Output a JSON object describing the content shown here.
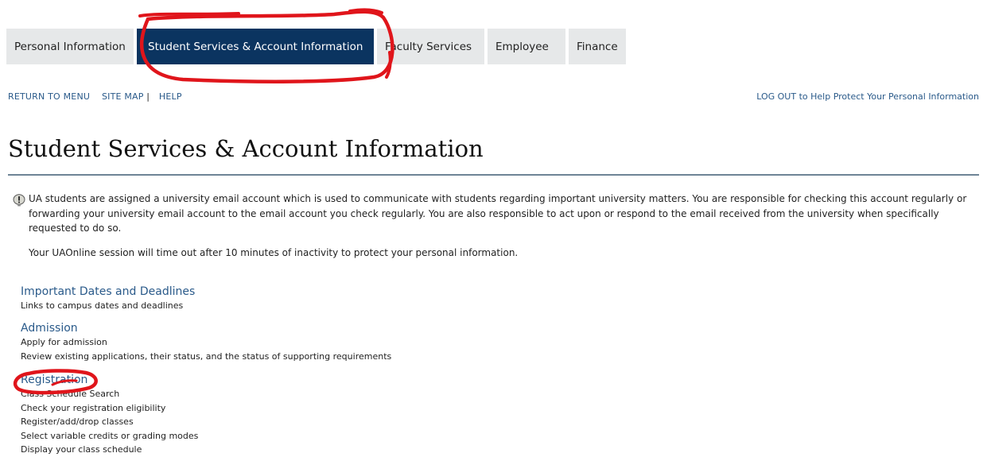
{
  "tabs": [
    {
      "label": "Personal Information"
    },
    {
      "label": "Student Services & Account Information"
    },
    {
      "label": "Faculty Services"
    },
    {
      "label": "Employee"
    },
    {
      "label": "Finance"
    }
  ],
  "nav": {
    "return_to_menu": "RETURN TO MENU",
    "site_map": "SITE MAP",
    "separator": "|",
    "help": "HELP",
    "logout": "LOG OUT to Help Protect Your Personal Information"
  },
  "page": {
    "title": "Student Services & Account Information",
    "info": "UA students are assigned a university email account which is used to communicate with students regarding important university matters. You are responsible for checking this account regularly or forwarding your university email account to the email account you check regularly. You are also responsible to act upon or respond to the email received from the university when specifically requested to do so.",
    "timeout_notice": "Your UAOnline session will time out after 10 minutes of inactivity to protect your personal information."
  },
  "menu": {
    "dates": {
      "title": "Important Dates and Deadlines",
      "desc": "Links to campus dates and deadlines"
    },
    "admission": {
      "title": "Admission",
      "items": [
        "Apply for admission",
        "Review existing applications, their status, and the status of supporting requirements"
      ]
    },
    "registration": {
      "title": "Registration",
      "items": [
        "Class Schedule Search",
        "Check your registration eligibility",
        "Register/add/drop classes",
        "Select variable credits or grading modes",
        "Display your class schedule"
      ]
    }
  },
  "icons": {
    "info": "info-icon"
  },
  "colors": {
    "active_tab": "#0b3460",
    "link": "#2a5a8a",
    "annotation": "#e0151b"
  }
}
